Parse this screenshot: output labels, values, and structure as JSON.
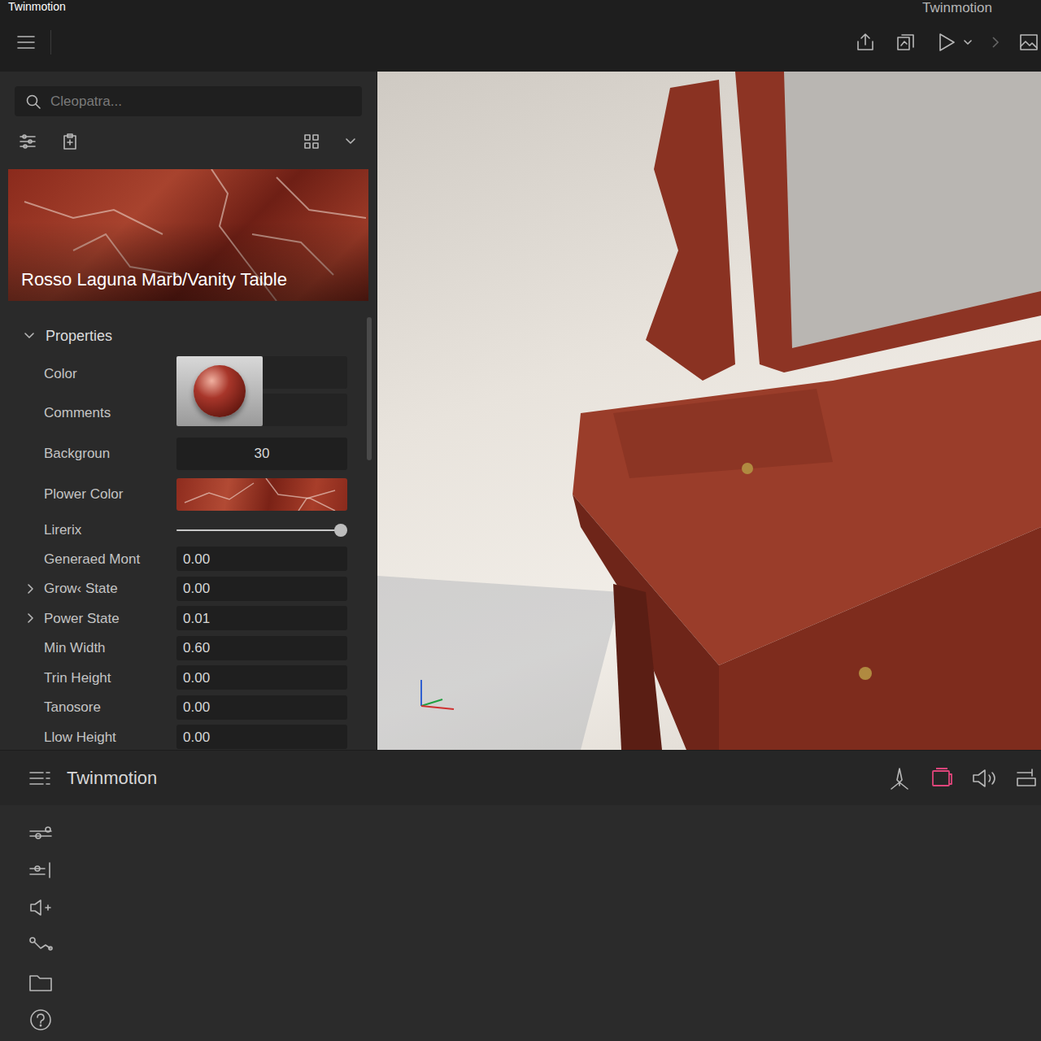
{
  "window": {
    "title": "Twinmotion",
    "title_right": "Twinmotion"
  },
  "search": {
    "placeholder": "Cleopatra..."
  },
  "material": {
    "name": "Rosso Laguna Marb/Vanity Taible"
  },
  "properties": {
    "title": "Properties",
    "expanded": true,
    "preview_rows": [
      {
        "label": "Color"
      },
      {
        "label": "Comments"
      }
    ],
    "rows": [
      {
        "label": "Backgroun",
        "kind": "number",
        "value": "30"
      },
      {
        "label": "Plower Color",
        "kind": "swatch"
      },
      {
        "label": "Lirerix",
        "kind": "slider",
        "level": 0.96
      },
      {
        "label": "Generaed Mont",
        "kind": "value",
        "value": "0.00"
      },
      {
        "label": "Grow‹ State",
        "kind": "group",
        "expanded": false,
        "value": "0.00"
      },
      {
        "label": "Power State",
        "kind": "group",
        "expanded": false,
        "value": "0.01"
      },
      {
        "label": "Min Width",
        "kind": "value",
        "value": "0.60"
      },
      {
        "label": "Trin Height",
        "kind": "value",
        "value": "0.00"
      },
      {
        "label": "Tanosore",
        "kind": "value",
        "value": "0.00"
      },
      {
        "label": "Llow Height",
        "kind": "value",
        "value": "0.00"
      }
    ]
  },
  "toolbar": {
    "title": "Twinmotion",
    "tools": [
      {
        "selected": false
      },
      {
        "selected": true
      },
      {
        "selected": false
      },
      {
        "selected": false
      }
    ]
  }
}
